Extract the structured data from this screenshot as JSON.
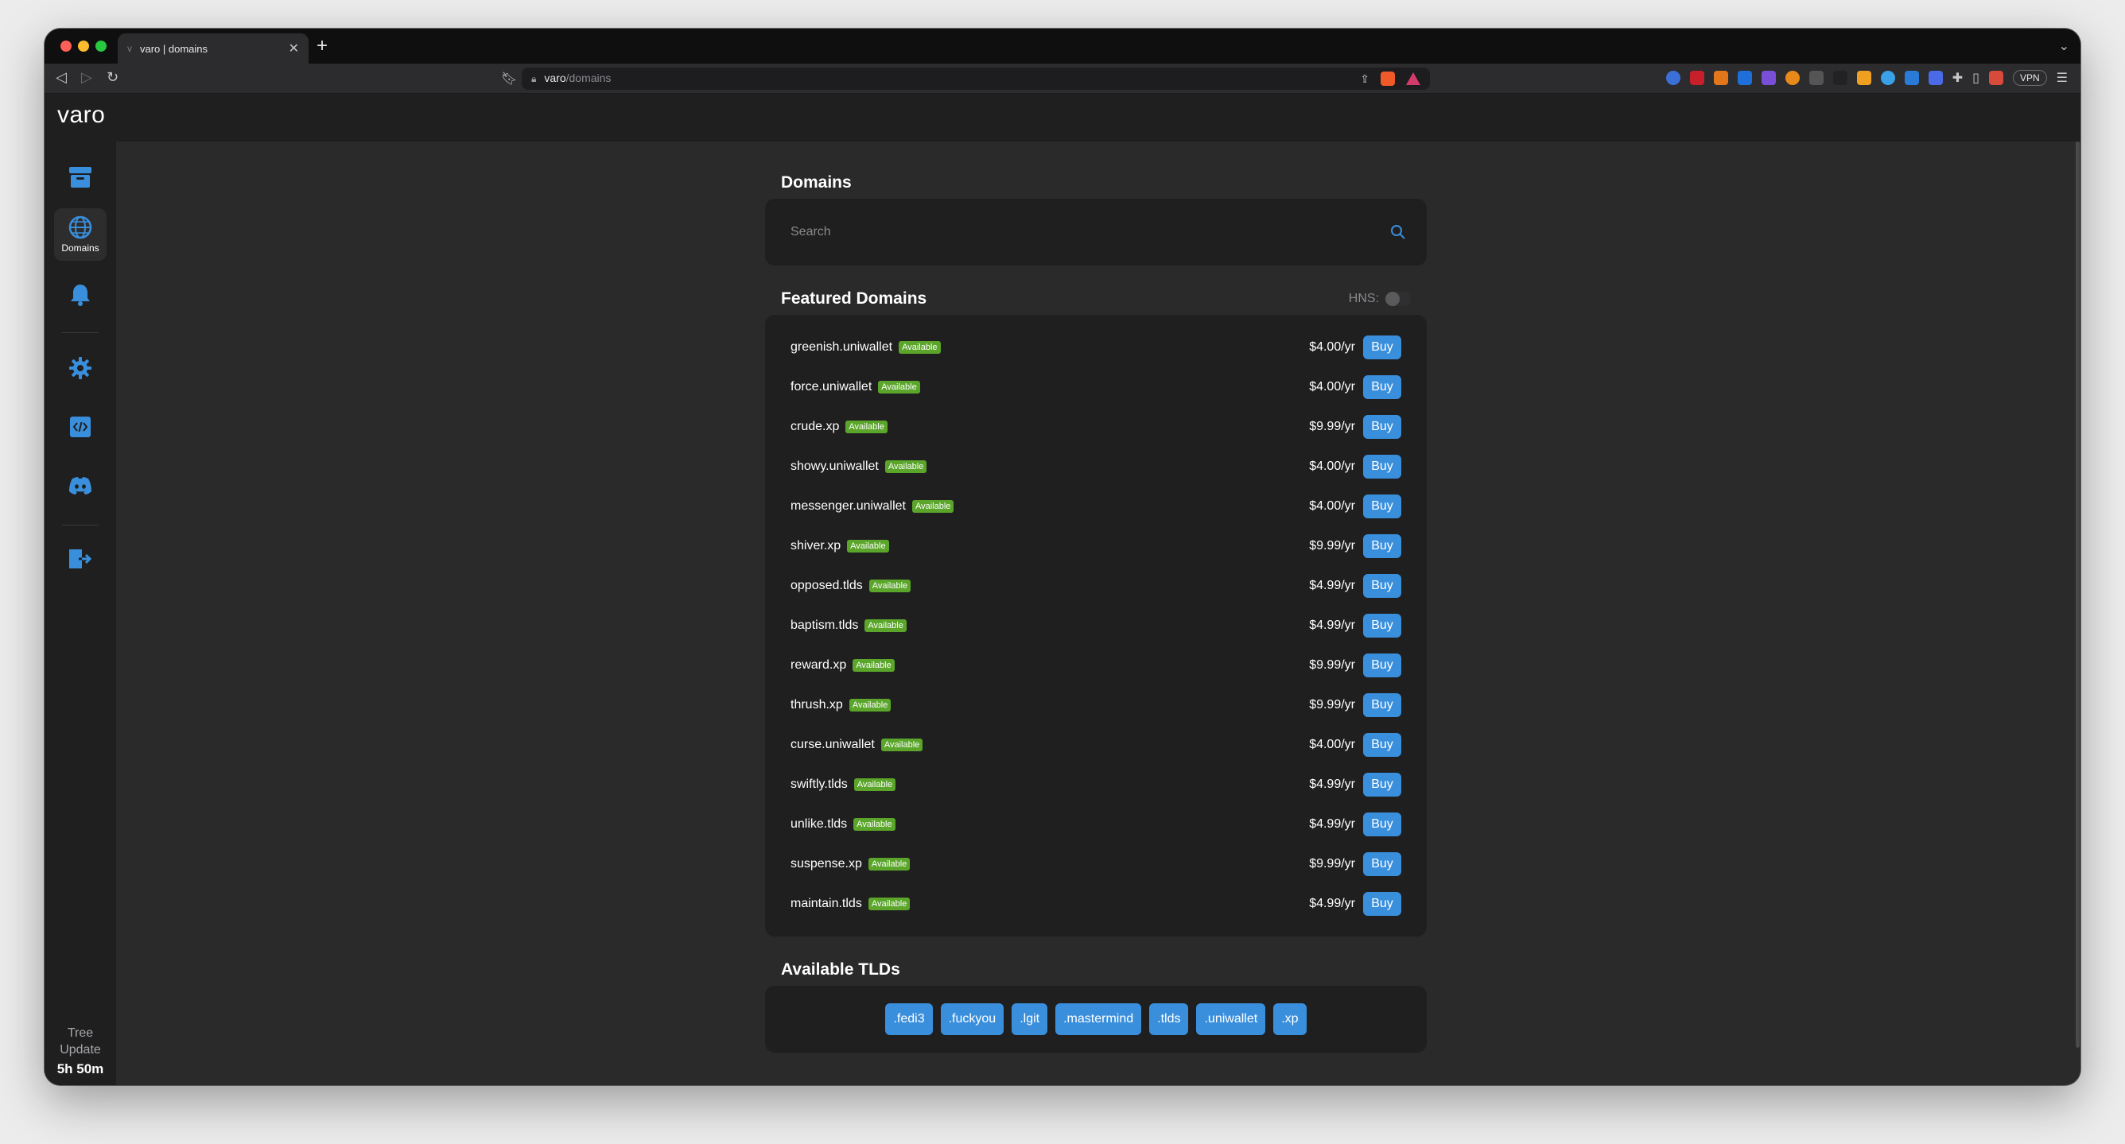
{
  "browser": {
    "tab_title": "varo | domains",
    "tab_favicon": "v",
    "url_host": "varo",
    "url_path": "/domains",
    "vpn_label": "VPN"
  },
  "app": {
    "brand": "varo",
    "sidebar": {
      "items": [
        {
          "icon": "archive-icon",
          "label": ""
        },
        {
          "icon": "globe-icon",
          "label": "Domains",
          "active": true
        },
        {
          "icon": "bell-icon",
          "label": ""
        },
        {
          "icon": "gear-icon",
          "label": ""
        },
        {
          "icon": "code-icon",
          "label": ""
        },
        {
          "icon": "discord-icon",
          "label": ""
        },
        {
          "icon": "logout-icon",
          "label": ""
        }
      ],
      "footer_line1": "Tree",
      "footer_line2": "Update",
      "footer_time": "5h 50m"
    },
    "accent_color": "#3a8fdc",
    "badge_color": "#5aa52a"
  },
  "domains_section": {
    "title": "Domains",
    "search_placeholder": "Search"
  },
  "featured": {
    "title": "Featured Domains",
    "hns_label": "HNS:",
    "rows": [
      {
        "name": "greenish.uniwallet",
        "status": "Available",
        "price": "$4.00/yr",
        "action": "Buy"
      },
      {
        "name": "force.uniwallet",
        "status": "Available",
        "price": "$4.00/yr",
        "action": "Buy"
      },
      {
        "name": "crude.xp",
        "status": "Available",
        "price": "$9.99/yr",
        "action": "Buy"
      },
      {
        "name": "showy.uniwallet",
        "status": "Available",
        "price": "$4.00/yr",
        "action": "Buy"
      },
      {
        "name": "messenger.uniwallet",
        "status": "Available",
        "price": "$4.00/yr",
        "action": "Buy"
      },
      {
        "name": "shiver.xp",
        "status": "Available",
        "price": "$9.99/yr",
        "action": "Buy"
      },
      {
        "name": "opposed.tlds",
        "status": "Available",
        "price": "$4.99/yr",
        "action": "Buy"
      },
      {
        "name": "baptism.tlds",
        "status": "Available",
        "price": "$4.99/yr",
        "action": "Buy"
      },
      {
        "name": "reward.xp",
        "status": "Available",
        "price": "$9.99/yr",
        "action": "Buy"
      },
      {
        "name": "thrush.xp",
        "status": "Available",
        "price": "$9.99/yr",
        "action": "Buy"
      },
      {
        "name": "curse.uniwallet",
        "status": "Available",
        "price": "$4.00/yr",
        "action": "Buy"
      },
      {
        "name": "swiftly.tlds",
        "status": "Available",
        "price": "$4.99/yr",
        "action": "Buy"
      },
      {
        "name": "unlike.tlds",
        "status": "Available",
        "price": "$4.99/yr",
        "action": "Buy"
      },
      {
        "name": "suspense.xp",
        "status": "Available",
        "price": "$9.99/yr",
        "action": "Buy"
      },
      {
        "name": "maintain.tlds",
        "status": "Available",
        "price": "$4.99/yr",
        "action": "Buy"
      }
    ]
  },
  "tlds": {
    "title": "Available TLDs",
    "items": [
      ".fedi3",
      ".fuckyou",
      ".lgit",
      ".mastermind",
      ".tlds",
      ".uniwallet",
      ".xp"
    ]
  }
}
